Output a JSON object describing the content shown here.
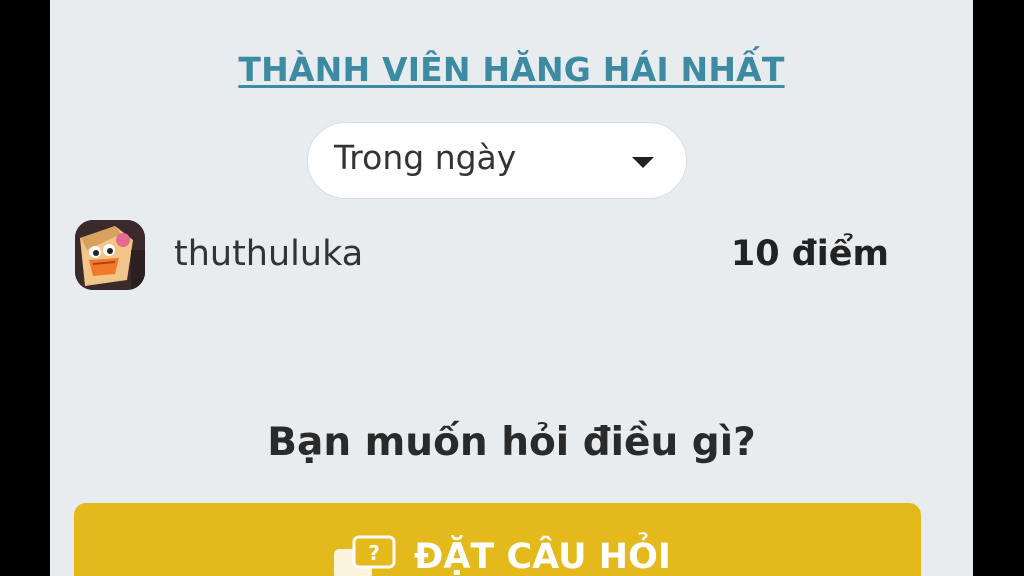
{
  "leaderboard": {
    "title": "THÀNH VIÊN HĂNG HÁI NHẤT",
    "period_select": {
      "selected": "Trong ngày"
    },
    "members": [
      {
        "username": "thuthuluka",
        "points": "10 điểm"
      }
    ]
  },
  "ask": {
    "heading": "Bạn muốn hỏi điều gì?",
    "button_label": "ĐẶT CÂU HỎI",
    "button_icon": "question-chat-icon"
  },
  "colors": {
    "title": "#3d8aa3",
    "button": "#e4b91c",
    "panel_bg": "#e9ecef"
  }
}
